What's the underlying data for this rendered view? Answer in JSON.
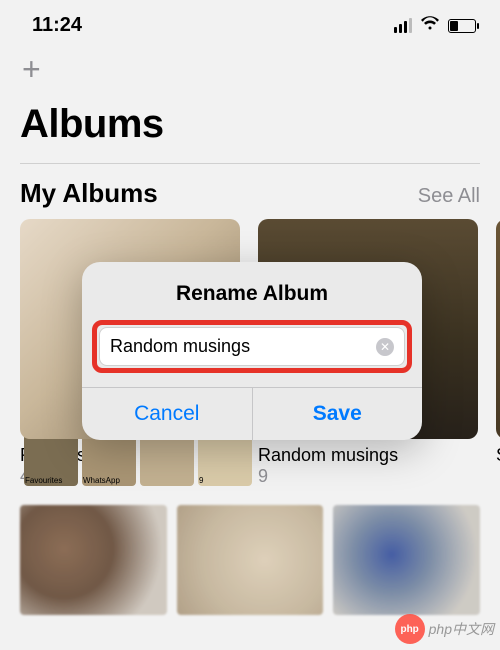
{
  "status": {
    "time": "11:24"
  },
  "toolbar": {
    "add_icon": "+"
  },
  "page": {
    "title": "Albums"
  },
  "section_my_albums": {
    "title": "My Albums",
    "see_all": "See All"
  },
  "albums": [
    {
      "name": "Recents",
      "count": "459"
    },
    {
      "name": "Random musings",
      "count": "9"
    },
    {
      "name": "S",
      "count": ""
    }
  ],
  "mini_behind": {
    "name": "Recents",
    "count": "458",
    "tiles": [
      "Favourites",
      "WhatsApp"
    ],
    "tile_counts": [
      "",
      "9"
    ]
  },
  "modal": {
    "title": "Rename Album",
    "input_value": "Random musings",
    "cancel": "Cancel",
    "save": "Save",
    "clear_glyph": "✕"
  },
  "watermark": {
    "badge": "php",
    "text": "php中文网"
  },
  "colors": {
    "accent": "#007aff",
    "highlight_border": "#e63228"
  }
}
